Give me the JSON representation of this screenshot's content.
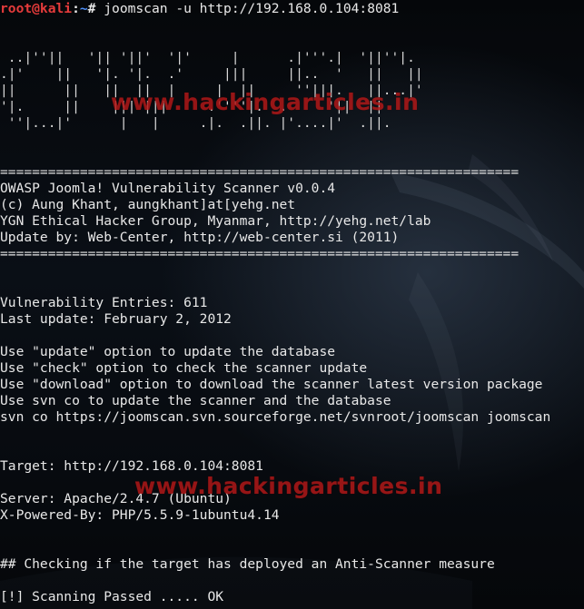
{
  "prompt": {
    "user_host": "root@kali",
    "separator": ":",
    "path": "~",
    "symbol": "# ",
    "command": "joomscan -u http://192.168.0.104:8081"
  },
  "watermark": "www.hackingarticles.in",
  "output_lines": [
    "",
    "",
    " ..|''||   '|| '||'  '|'     |      .|'''.|  '||''|.",
    ".|'    ||   '|. '|.  .'     |||     ||..  '   ||   ||",
    "||      ||   ||  ||  |     |  ||     ''|||.   ||...|'",
    "'|.     ||    ||| |||     .''''|.  .     '||  ||",
    " ''|...|'      |   |     .|.  .||. |'....|'  .||.",
    "",
    "",
    "=================================================================",
    "OWASP Joomla! Vulnerability Scanner v0.0.4",
    "(c) Aung Khant, aungkhant]at[yehg.net",
    "YGN Ethical Hacker Group, Myanmar, http://yehg.net/lab",
    "Update by: Web-Center, http://web-center.si (2011)",
    "=================================================================",
    "",
    "",
    "Vulnerability Entries: 611",
    "Last update: February 2, 2012",
    "",
    "Use \"update\" option to update the database",
    "Use \"check\" option to check the scanner update",
    "Use \"download\" option to download the scanner latest version package",
    "Use svn co to update the scanner and the database",
    "svn co https://joomscan.svn.sourceforge.net/svnroot/joomscan joomscan",
    "",
    "",
    "Target: http://192.168.0.104:8081",
    "",
    "Server: Apache/2.4.7 (Ubuntu)",
    "X-Powered-By: PHP/5.5.9-1ubuntu4.14",
    "",
    "",
    "## Checking if the target has deployed an Anti-Scanner measure",
    "",
    "[!] Scanning Passed ..... OK"
  ]
}
